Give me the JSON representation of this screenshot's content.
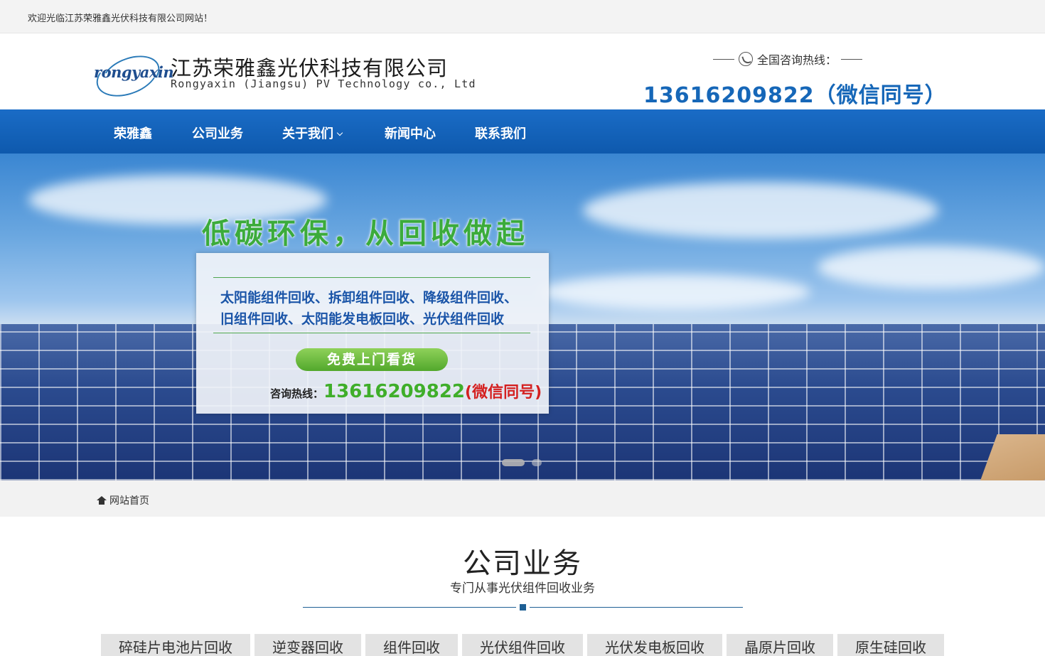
{
  "topbar": {
    "welcome": "欢迎光临江苏荣雅鑫光伏科技有限公司网站！"
  },
  "header": {
    "logo_mark": "rongyaxin",
    "company_cn": "江苏荣雅鑫光伏科技有限公司",
    "company_en": "Rongyaxin (Jiangsu) PV Technology co., Ltd",
    "hotline_label": "全国咨询热线：",
    "hotline_number": "13616209822（微信同号）"
  },
  "nav": {
    "items": [
      {
        "label": "荣雅鑫"
      },
      {
        "label": "公司业务"
      },
      {
        "label": "关于我们"
      },
      {
        "label": "新闻中心"
      },
      {
        "label": "联系我们"
      }
    ]
  },
  "banner": {
    "title": "低碳环保，从回收做起",
    "line1": "太阳能组件回收、拆卸组件回收、降级组件回收、",
    "line2": "旧组件回收、太阳能发电板回收、光伏组件回收",
    "button": "免费上门看货",
    "hotline_label": "咨询热线：",
    "hotline_number": "13616209822",
    "hotline_note": "(微信同号)",
    "active_slide": 1,
    "slide_count": 2
  },
  "breadcrumb": {
    "home": "网站首页"
  },
  "section": {
    "title": "公司业务",
    "subtitle": "专门从事光伏组件回收业务",
    "tabs": [
      {
        "label": "碎硅片电池片回收"
      },
      {
        "label": "逆变器回收"
      },
      {
        "label": "组件回收"
      },
      {
        "label": "光伏组件回收"
      },
      {
        "label": "光伏发电板回收"
      },
      {
        "label": "晶原片回收"
      },
      {
        "label": "原生硅回收"
      }
    ]
  },
  "colors": {
    "nav_blue": "#1a6cc6",
    "hotline_blue": "#1667b8",
    "banner_green": "#3bab3b",
    "banner_red": "#d42020",
    "divider": "#1e5f94"
  }
}
